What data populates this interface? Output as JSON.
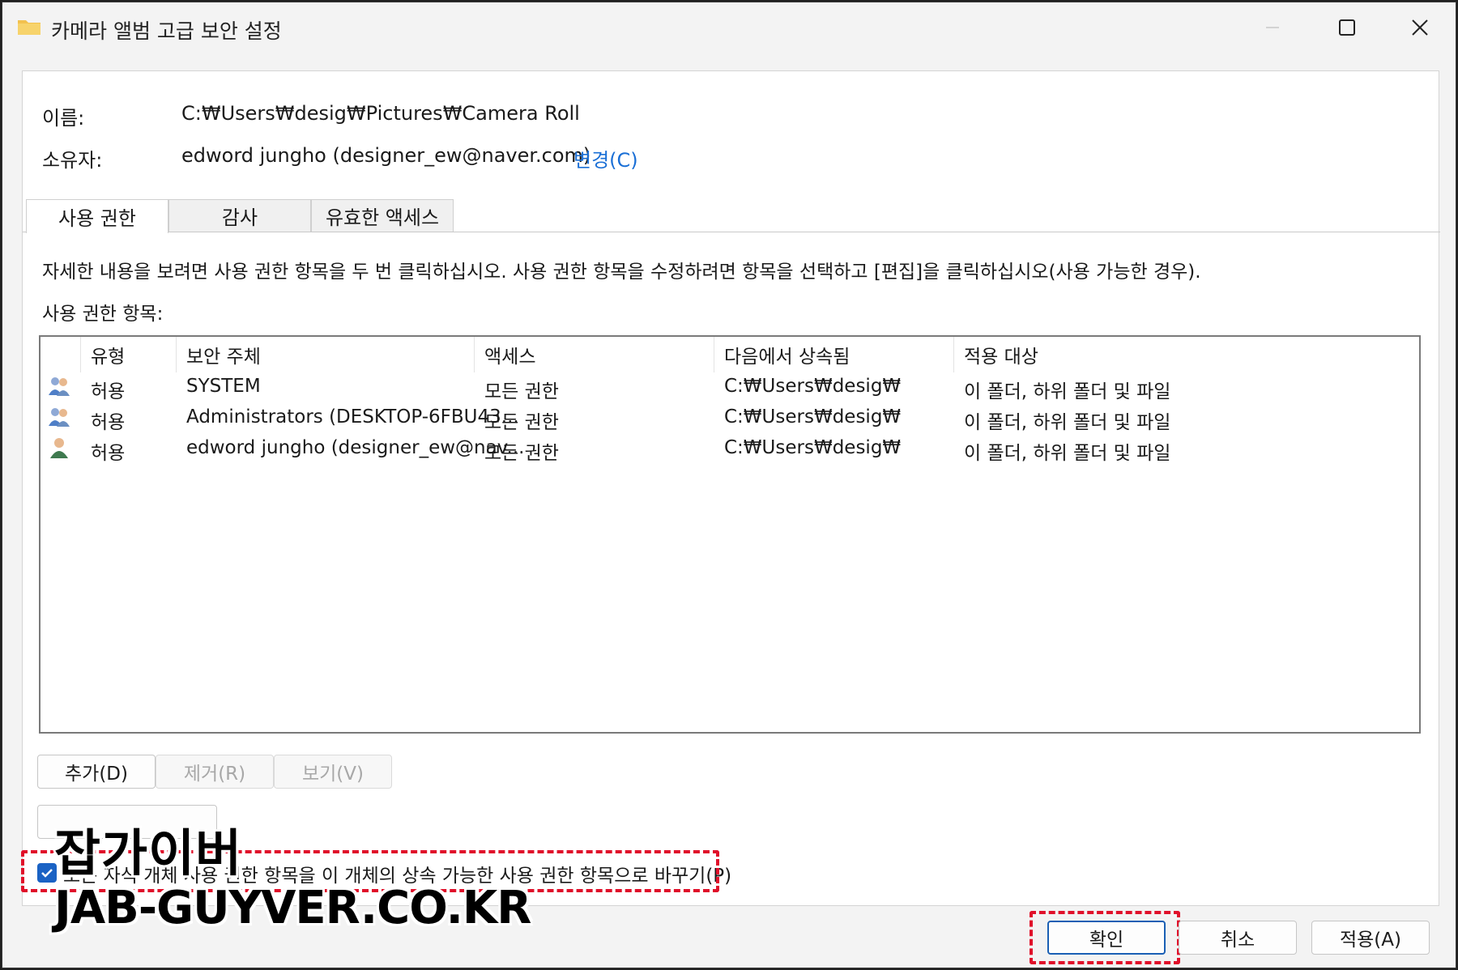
{
  "window": {
    "title": "카메라 앨범 고급 보안 설정",
    "icon": "folder-icon"
  },
  "info": {
    "name_label": "이름:",
    "name_value": "C:₩Users₩desig₩Pictures₩Camera Roll",
    "owner_label": "소유자:",
    "owner_value": "edword jungho (designer_ew@naver.com)",
    "change_link": "변경(C)"
  },
  "tabs": [
    {
      "label": "사용 권한",
      "active": true
    },
    {
      "label": "감사",
      "active": false
    },
    {
      "label": "유효한 액세스",
      "active": false
    }
  ],
  "instructions": "자세한 내용을 보려면 사용 권한 항목을 두 번 클릭하십시오. 사용 권한 항목을 수정하려면 항목을 선택하고 [편집]을 클릭하십시오(사용 가능한 경우).",
  "entries_label": "사용 권한 항목:",
  "table": {
    "columns": [
      "유형",
      "보안 주체",
      "액세스",
      "다음에서 상속됨",
      "적용 대상"
    ],
    "rows": [
      {
        "icon": "group-users-icon",
        "type": "허용",
        "principal": "SYSTEM",
        "access": "모든 권한",
        "inherited": "C:₩Users₩desig₩",
        "applies": "이 폴더, 하위 폴더 및 파일"
      },
      {
        "icon": "group-users-icon",
        "type": "허용",
        "principal": "Administrators (DESKTOP-6FBU43...",
        "access": "모든 권한",
        "inherited": "C:₩Users₩desig₩",
        "applies": "이 폴더, 하위 폴더 및 파일"
      },
      {
        "icon": "user-icon",
        "type": "허용",
        "principal": "edword jungho (designer_ew@nav...",
        "access": "모든 권한",
        "inherited": "C:₩Users₩desig₩",
        "applies": "이 폴더, 하위 폴더 및 파일"
      }
    ]
  },
  "buttons": {
    "add": "추가(D)",
    "remove": "제거(R)",
    "view": "보기(V)",
    "ok": "확인",
    "cancel": "취소",
    "apply": "적용(A)"
  },
  "checkbox": {
    "checked": true,
    "label": "모든 자식 개체 사용 권한 항목을 이 개체의 상속 가능한 사용 권한 항목으로 바꾸기(P)"
  },
  "watermark": {
    "line1": "잡가이버",
    "line2": "JAB-GUYVER.CO.KR"
  },
  "colors": {
    "accent": "#1a62c4",
    "link": "#1a6fd6",
    "highlight_dash": "#e0102a"
  }
}
